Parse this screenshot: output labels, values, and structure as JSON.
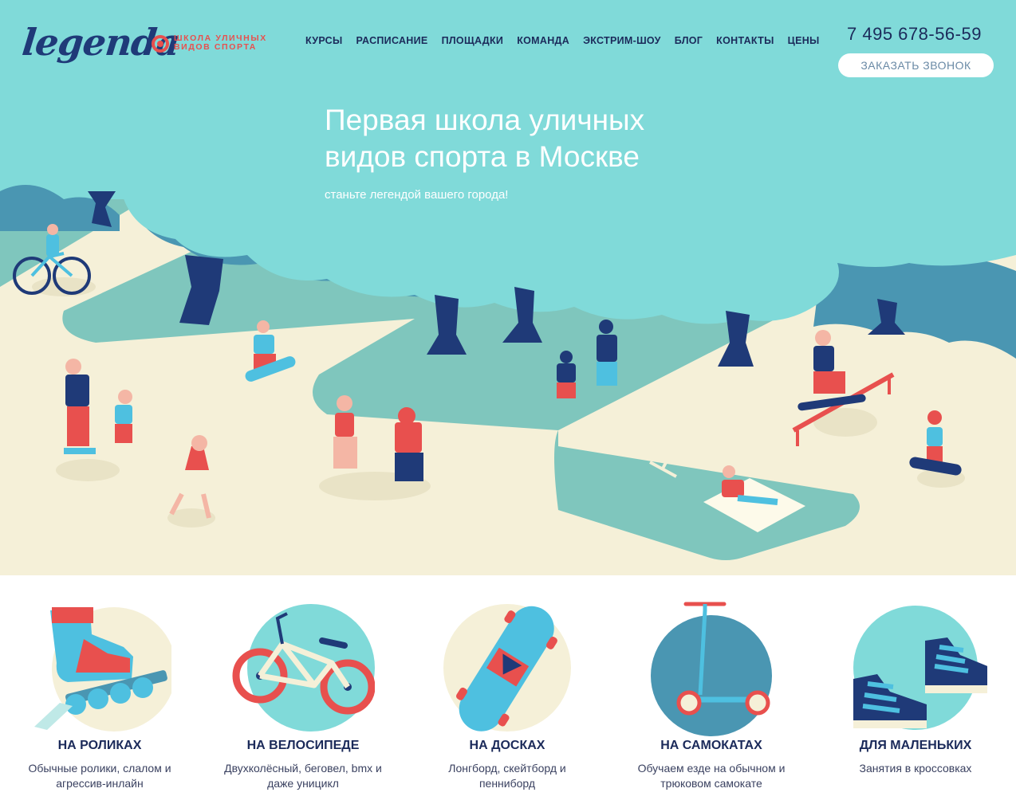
{
  "header": {
    "logo_word": "legenda",
    "logo_tag_line1": "школа уличных",
    "logo_tag_line2": "видов спорта",
    "nav": [
      "КУРСЫ",
      "РАСПИСАНИЕ",
      "ПЛОЩАДКИ",
      "КОМАНДА",
      "ЭКСТРИМ-ШОУ",
      "БЛОГ",
      "КОНТАКТЫ",
      "ЦЕНЫ"
    ],
    "phone": "7 495 678-56-59",
    "call_button": "ЗАКАЗАТЬ ЗВОНОК"
  },
  "hero": {
    "title_line1": "Первая школа уличных",
    "title_line2": "видов спорта в Москве",
    "subtitle": "станьте легендой вашего города!"
  },
  "categories": [
    {
      "title": "НА РОЛИКАХ",
      "desc": "Обычные ролики, слалом и агрессив-инлайн",
      "icon": "inline-skate-icon"
    },
    {
      "title": "НА ВЕЛОСИПЕДЕ",
      "desc": "Двухколёсный, беговел, bmx и даже уницикл",
      "icon": "bicycle-icon"
    },
    {
      "title": "НА ДОСКАХ",
      "desc": "Лонгборд, скейтборд и пенниборд",
      "icon": "longboard-icon"
    },
    {
      "title": "НА САМОКАТАХ",
      "desc": "Обучаем езде на обычном и трюковом самокате",
      "icon": "scooter-icon"
    },
    {
      "title": "ДЛЯ МАЛЕНЬКИХ",
      "desc": "Занятия в кроссовках",
      "icon": "sneakers-icon"
    }
  ],
  "colors": {
    "sky": "#80dad9",
    "path": "#7fc6bd",
    "ground": "#f5f0d8",
    "trees": "#4a96b2",
    "trunk": "#1f3a78",
    "accent": "#e8504e",
    "navy": "#1b2a5a"
  }
}
